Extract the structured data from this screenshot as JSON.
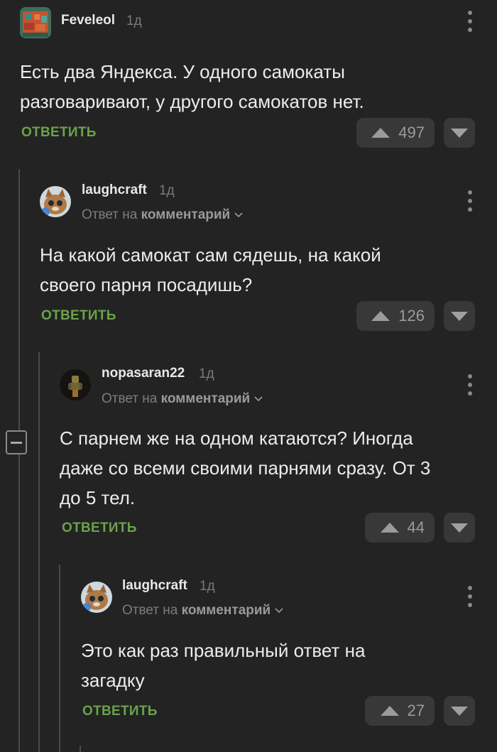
{
  "comments": [
    {
      "author": "Feveleol",
      "age": "1д",
      "text": "Есть два Яндекса. У одного самокаты\nразговаривают, у другого самокатов нет.",
      "reply_label": "ОТВЕТИТЬ",
      "rating": "497"
    },
    {
      "author": "laughcraft",
      "age": "1д",
      "reply_prefix": "Ответ на",
      "reply_target": "комментарий",
      "text": "На какой самокат сам сядешь, на какой\nсвоего парня посадишь?",
      "reply_label": "ОТВЕТИТЬ",
      "rating": "126"
    },
    {
      "author": "nopasaran22",
      "age": "1д",
      "reply_prefix": "Ответ на",
      "reply_target": "комментарий",
      "text": "С парнем же на одном катаются? Иногда\nдаже со всеми своими парнями сразу. От 3\nдо 5 тел.",
      "reply_label": "ОТВЕТИТЬ",
      "rating": "44"
    },
    {
      "author": "laughcraft",
      "age": "1д",
      "reply_prefix": "Ответ на",
      "reply_target": "комментарий",
      "text": "Это как раз правильный ответ на\nзагадку",
      "reply_label": "ОТВЕТИТЬ",
      "rating": "27"
    }
  ],
  "colors": {
    "background": "#232323",
    "reply_green": "#6aa34a",
    "vote_bg": "#383838"
  },
  "icons": {
    "vote_up": "triangle-up-icon",
    "vote_down": "triangle-down-icon",
    "menu": "more-vertical-icon",
    "collapse": "minus-square-icon"
  }
}
